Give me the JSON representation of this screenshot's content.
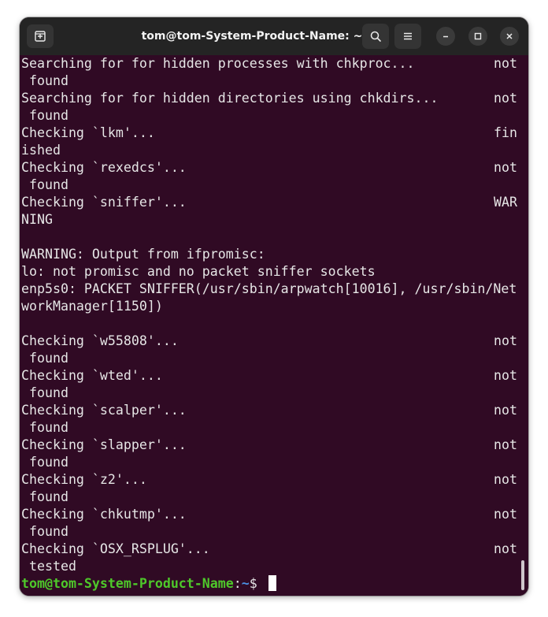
{
  "window": {
    "title": "tom@tom-System-Product-Name: ~",
    "bg_color": "#300a24",
    "titlebar_color": "#242424"
  },
  "icons": {
    "new_tab": "new-tab-icon",
    "search": "search-icon",
    "menu": "hamburger-menu-icon",
    "minimize": "minimize-icon",
    "maximize": "maximize-icon",
    "close": "close-icon"
  },
  "terminal": {
    "lines": [
      {
        "left": "Searching for for hidden processes with chkproc...",
        "right": "not"
      },
      {
        "left": " found",
        "right": ""
      },
      {
        "left": "Searching for for hidden directories using chkdirs...",
        "right": "not"
      },
      {
        "left": " found",
        "right": ""
      },
      {
        "left": "Checking `lkm'...",
        "right": "fin"
      },
      {
        "left": "ished",
        "right": ""
      },
      {
        "left": "Checking `rexedcs'...",
        "right": "not"
      },
      {
        "left": " found",
        "right": ""
      },
      {
        "left": "Checking `sniffer'...",
        "right": "WAR"
      },
      {
        "left": "NING",
        "right": ""
      },
      {
        "left": "",
        "right": ""
      },
      {
        "left": "WARNING: Output from ifpromisc:",
        "right": ""
      },
      {
        "left": "lo: not promisc and no packet sniffer sockets",
        "right": ""
      },
      {
        "left": "enp5s0: PACKET SNIFFER(/usr/sbin/arpwatch[10016], /usr/sbin/Net",
        "right": ""
      },
      {
        "left": "workManager[1150])",
        "right": ""
      },
      {
        "left": "",
        "right": ""
      },
      {
        "left": "Checking `w55808'...",
        "right": "not"
      },
      {
        "left": " found",
        "right": ""
      },
      {
        "left": "Checking `wted'...",
        "right": "not"
      },
      {
        "left": " found",
        "right": ""
      },
      {
        "left": "Checking `scalper'...",
        "right": "not"
      },
      {
        "left": " found",
        "right": ""
      },
      {
        "left": "Checking `slapper'...",
        "right": "not"
      },
      {
        "left": " found",
        "right": ""
      },
      {
        "left": "Checking `z2'...",
        "right": "not"
      },
      {
        "left": " found",
        "right": ""
      },
      {
        "left": "Checking `chkutmp'...",
        "right": "not"
      },
      {
        "left": " found",
        "right": ""
      },
      {
        "left": "Checking `OSX_RSPLUG'...",
        "right": "not"
      },
      {
        "left": " tested",
        "right": ""
      }
    ],
    "prompt": {
      "user_host": "tom@tom-System-Product-Name",
      "separator": ":",
      "path": "~",
      "symbol": "$ ",
      "user_color": "#4ec82a",
      "path_color": "#4a90e2"
    }
  }
}
